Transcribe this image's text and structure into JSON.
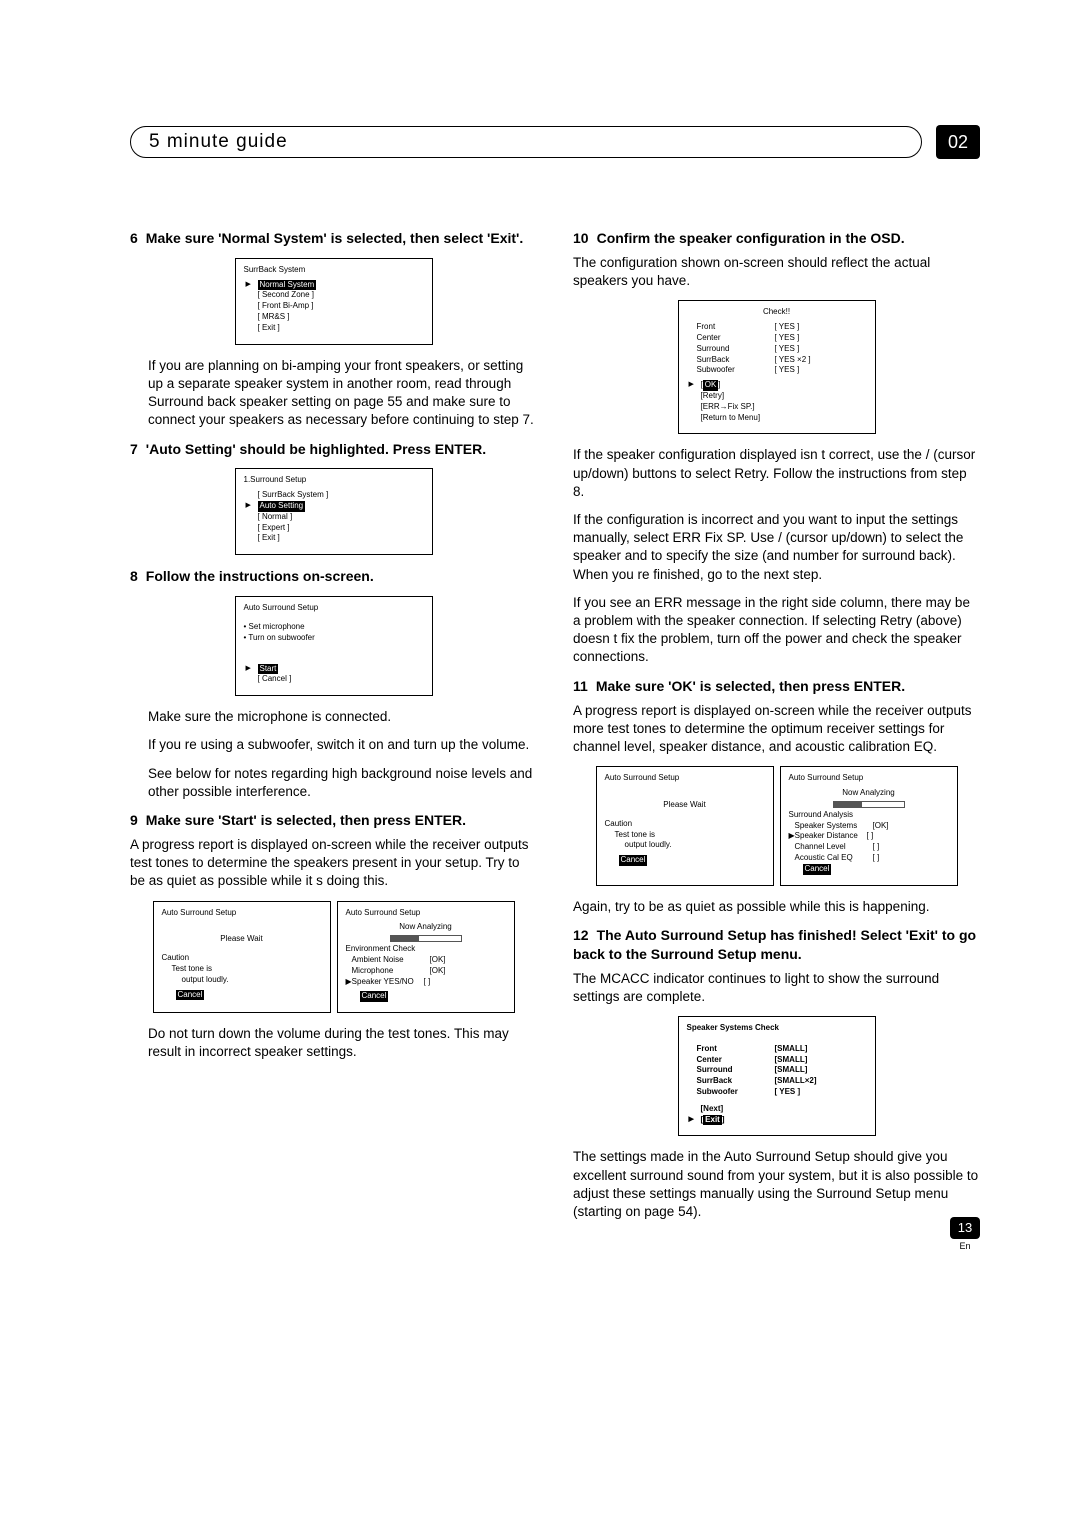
{
  "header": {
    "title": "5 minute guide",
    "chapter": "02"
  },
  "footer": {
    "page": "13",
    "lang": "En"
  },
  "left": {
    "step6": {
      "num": "6",
      "head1": "Make sure 'Normal System' is selected, then select 'Exit'.",
      "osd": {
        "title": "SurrBack System",
        "items": [
          "Normal System",
          "Second Zone",
          "Front Bi-Amp",
          "MR&S",
          "Exit"
        ],
        "active": 0
      },
      "p1": "If you are planning on bi-amping your front speakers, or setting up a separate speaker system in another room, read through Surround back speaker setting on page 55 and make sure to connect your speakers as necessary before continuing to step 7."
    },
    "step7": {
      "num": "7",
      "head": "'Auto Setting' should be highlighted. Press ENTER.",
      "osd": {
        "title": "1.Surround Setup",
        "items": [
          "SurrBack System",
          "Auto Setting",
          "Normal",
          "Expert",
          "Exit"
        ],
        "active": 1
      }
    },
    "step8": {
      "num": "8",
      "head": "Follow the instructions on-screen.",
      "osd1": {
        "title": "Auto Surround Setup",
        "lines": [
          "Set microphone",
          "Turn on subwoofer"
        ],
        "buttons": [
          "Start",
          "Cancel"
        ],
        "active": 0
      },
      "p1": "Make sure the microphone is connected.",
      "p2": "If you re using a subwoofer, switch it on and turn up the volume.",
      "p3": "See below for notes regarding high background noise levels and other possible interference."
    },
    "step9": {
      "num": "9",
      "head": "Make sure 'Start' is selected, then press ENTER.",
      "p1": "A progress report is displayed on-screen while the receiver outputs test tones to determine the speakers present in your setup. Try to be as quiet as possible while it s doing this.",
      "osdA": {
        "title": "Auto Surround Setup",
        "l1": "Please Wait",
        "l2": "Caution",
        "l3": "Test tone is",
        "l4": "output loudly.",
        "btn": "Cancel"
      },
      "osdB": {
        "title": "Auto Surround Setup",
        "l0": "Now Analyzing",
        "l1": "Environment Check",
        "l2": "Ambient Noise",
        "l3": "Microphone",
        "l4": "Speaker YES/NO",
        "ok1": "[OK]",
        "ok2": "[OK]",
        "ok3": "[    ]",
        "btn": "Cancel"
      },
      "p2": "Do not turn down the volume during the test tones. This may result in incorrect speaker settings."
    }
  },
  "right": {
    "step10": {
      "num": "10",
      "head": "Confirm the speaker configuration in the OSD.",
      "p1": "The configuration shown on-screen should reflect the actual speakers you have.",
      "osd": {
        "title": "Check!!",
        "rows": [
          {
            "l": "Front",
            "v": "[ YES  ]"
          },
          {
            "l": "Center",
            "v": "[ YES  ]"
          },
          {
            "l": "Surround",
            "v": "[ YES  ]"
          },
          {
            "l": "SurrBack",
            "v": "[ YES ×2 ]"
          },
          {
            "l": "Subwoofer",
            "v": "[ YES  ]"
          }
        ],
        "buttons": [
          "OK",
          "Retry",
          "ERR→Fix SP.",
          "Return to Menu"
        ],
        "active": 0
      },
      "p2": "If the speaker configuration displayed isn t correct, use the  /  (cursor up/down) buttons to select Retry. Follow the instructions from step 8.",
      "p3": "If the configuration is incorrect and you want to input the settings manually, select ERR  Fix SP. Use  /  (cursor up/down) to select the speaker and to specify the size (and number for surround back). When you re finished, go to the next step.",
      "p4": "If you see an ERR message in the right side column, there may be a problem with the speaker connection. If selecting Retry (above) doesn t fix the problem, turn off the power and check the speaker connections."
    },
    "step11": {
      "num": "11",
      "head": "Make sure 'OK' is selected, then press ENTER.",
      "p1": "A progress report is displayed on-screen while the receiver outputs more test tones to determine the optimum receiver settings for channel level, speaker distance, and acoustic calibration EQ.",
      "osdA": {
        "title": "Auto Surround Setup",
        "l1": "Please Wait",
        "l2": "Caution",
        "l3": "Test tone is",
        "l4": "output loudly.",
        "btn": "Cancel"
      },
      "osdB": {
        "title": "Auto Surround Setup",
        "l0": "Now Analyzing",
        "h": "Surround Analysis",
        "r1": "Speaker Systems",
        "ok1": "[OK]",
        "r2": "Speaker Distance",
        "ok2": "[    ]",
        "r3": "Channel Level",
        "ok3": "[    ]",
        "r4": "Acoustic Cal EQ",
        "ok4": "[    ]",
        "btn": "Cancel"
      },
      "p2": "Again, try to be as quiet as possible while this is happening."
    },
    "step12": {
      "num": "12",
      "head": "The Auto Surround Setup has finished! Select 'Exit' to go back to the Surround Setup menu.",
      "p1": "The MCACC indicator continues to light to show the surround settings are complete.",
      "osd": {
        "title": "Speaker Systems Check",
        "rows": [
          {
            "l": "Front",
            "v": "[SMALL]"
          },
          {
            "l": "Center",
            "v": "[SMALL]"
          },
          {
            "l": "Surround",
            "v": "[SMALL]"
          },
          {
            "l": "SurrBack",
            "v": "[SMALL×2]"
          },
          {
            "l": "Subwoofer",
            "v": "[ YES  ]"
          }
        ],
        "buttons": [
          "Next",
          "Exit"
        ],
        "active": 1
      },
      "p2": "The settings made in the Auto Surround Setup should give you excellent surround sound from your system, but it is also possible to adjust these settings manually using the Surround Setup menu (starting on page 54)."
    }
  }
}
